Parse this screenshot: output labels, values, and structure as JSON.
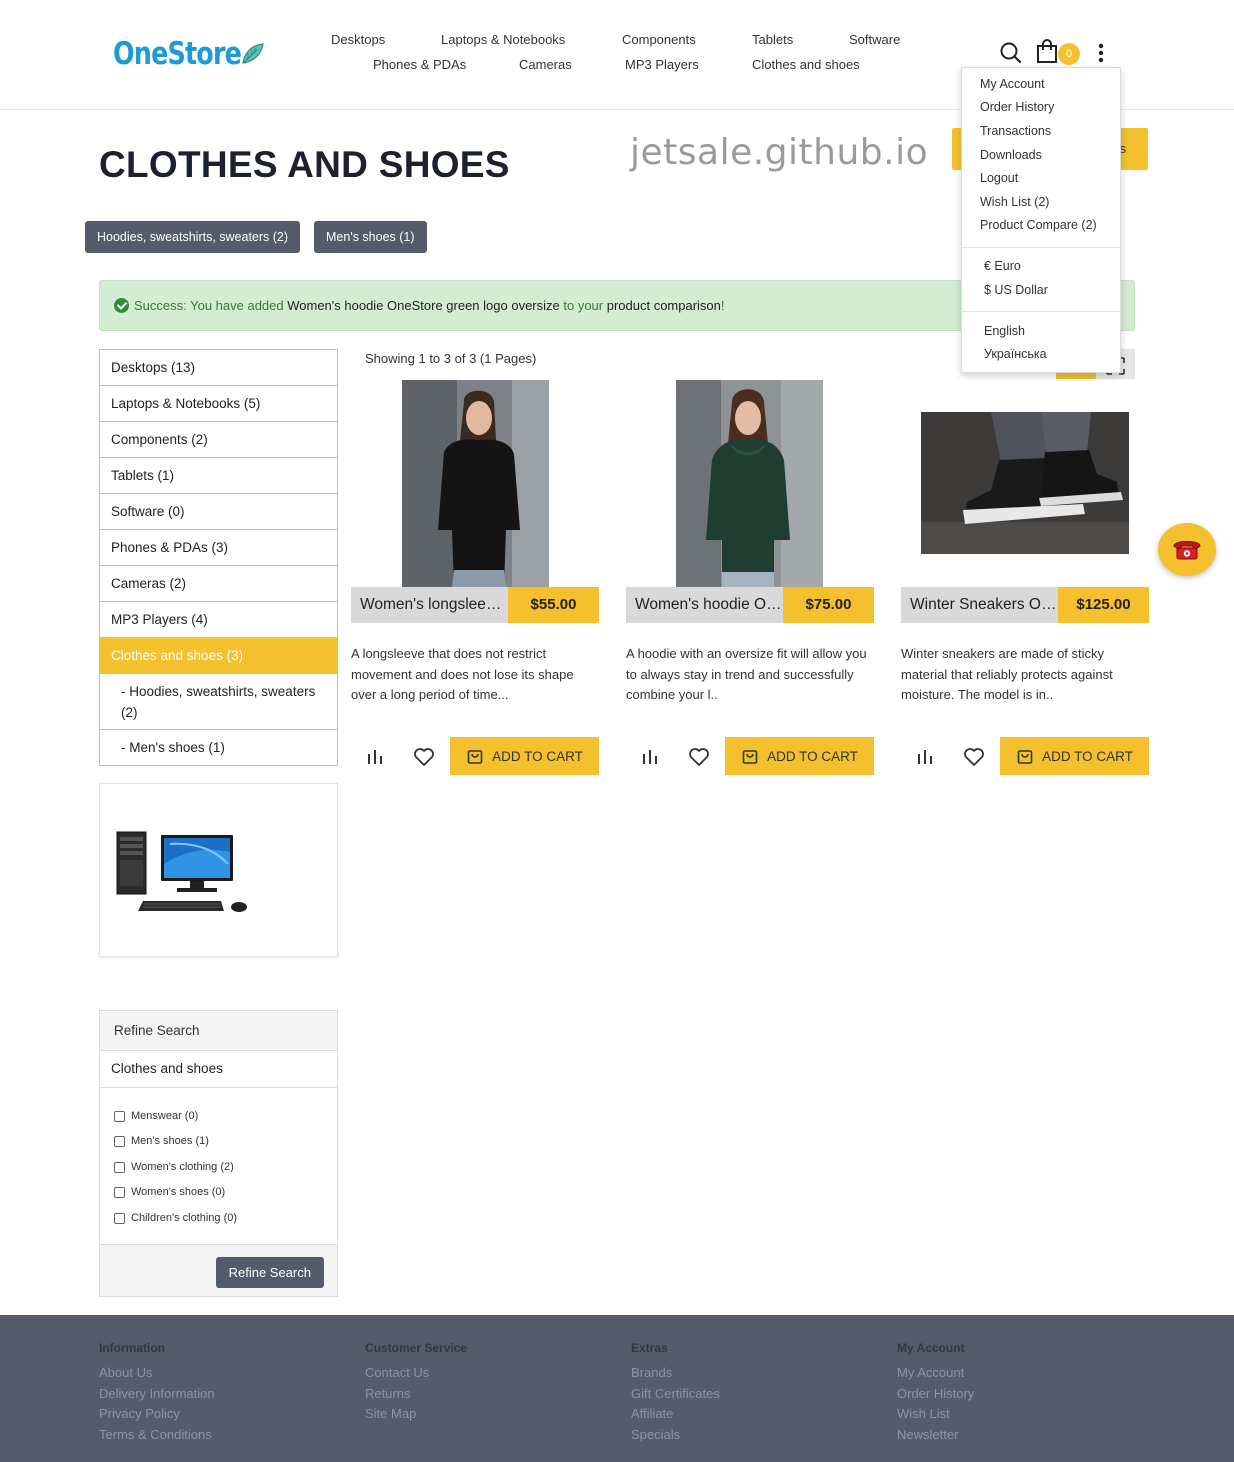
{
  "brand": {
    "name": "OneStore"
  },
  "nav": {
    "row1": [
      "Desktops",
      "Laptops & Notebooks",
      "Components",
      "Tablets",
      "Software"
    ],
    "row2": [
      "Phones & PDAs",
      "Cameras",
      "MP3 Players",
      "Clothes and shoes"
    ]
  },
  "cart": {
    "count": "0"
  },
  "account_menu": {
    "items": [
      "My Account",
      "Order History",
      "Transactions",
      "Downloads",
      "Logout",
      "Wish List (2)",
      "Product Compare (2)"
    ],
    "currencies": [
      "€ Euro",
      "$ US Dollar"
    ],
    "languages": [
      "English",
      "Українська"
    ]
  },
  "watermark": "jetsale.github.io",
  "page": {
    "title": "CLOTHES AND SHOES",
    "top_button_tail": "s"
  },
  "subcategories": [
    "Hoodies, sweatshirts, sweaters (2)",
    "Men's shoes (1)"
  ],
  "alert": {
    "part1": "Success: You have added ",
    "product": "Women's hoodie OneStore green logo oversize",
    "part2": " to your ",
    "link": "product comparison",
    "end": "!"
  },
  "sidebar": {
    "categories": [
      "Desktops (13)",
      "Laptops & Notebooks (5)",
      "Components (2)",
      "Tablets (1)",
      "Software (0)",
      "Phones & PDAs (3)",
      "Cameras (2)",
      "MP3 Players (4)",
      "Clothes and shoes (3)",
      "- Hoodies, sweatshirts, sweaters (2)",
      "- Men's shoes (1)"
    ]
  },
  "refine": {
    "heading": "Refine Search",
    "category": "Clothes and shoes",
    "options": [
      "Menswear (0)",
      "Men's shoes (1)",
      "Women's clothing (2)",
      "Women's shoes (0)",
      "Children's clothing (0)"
    ],
    "button": "Refine Search"
  },
  "listing": {
    "showing": "Showing 1 to 3 of 3 (1 Pages)"
  },
  "products": [
    {
      "name": "Women's longsleeve OneStore",
      "price": "$55.00",
      "description": "A longsleeve that does not restrict movement and does not lose its shape over a long period of time...",
      "cart_label": "ADD TO CART"
    },
    {
      "name": "Women's hoodie OneStore green logo oversize",
      "price": "$75.00",
      "description": "A hoodie with an oversize fit will allow you to always stay in trend and successfully combine your l..",
      "cart_label": "ADD TO CART"
    },
    {
      "name": "Winter Sneakers OneStore",
      "price": "$125.00",
      "description": "Winter sneakers are made of sticky material that reliably protects against moisture. The model is in..",
      "cart_label": "ADD TO CART"
    }
  ],
  "footer": {
    "columns": [
      {
        "heading": "Information",
        "links": [
          "About Us",
          "Delivery Information",
          "Privacy Policy",
          "Terms & Conditions"
        ]
      },
      {
        "heading": "Customer Service",
        "links": [
          "Contact Us",
          "Returns",
          "Site Map"
        ]
      },
      {
        "heading": "Extras",
        "links": [
          "Brands",
          "Gift Certificates",
          "Affiliate",
          "Specials"
        ]
      },
      {
        "heading": "My Account",
        "links": [
          "My Account",
          "Order History",
          "Wish List",
          "Newsletter"
        ]
      }
    ]
  },
  "colors": {
    "accent": "#f4c02e",
    "dark_button": "#545b6b",
    "footer_bg": "#555b6a",
    "brand_blue": "#1c9bd6",
    "success_bg": "#d4ecd2"
  }
}
